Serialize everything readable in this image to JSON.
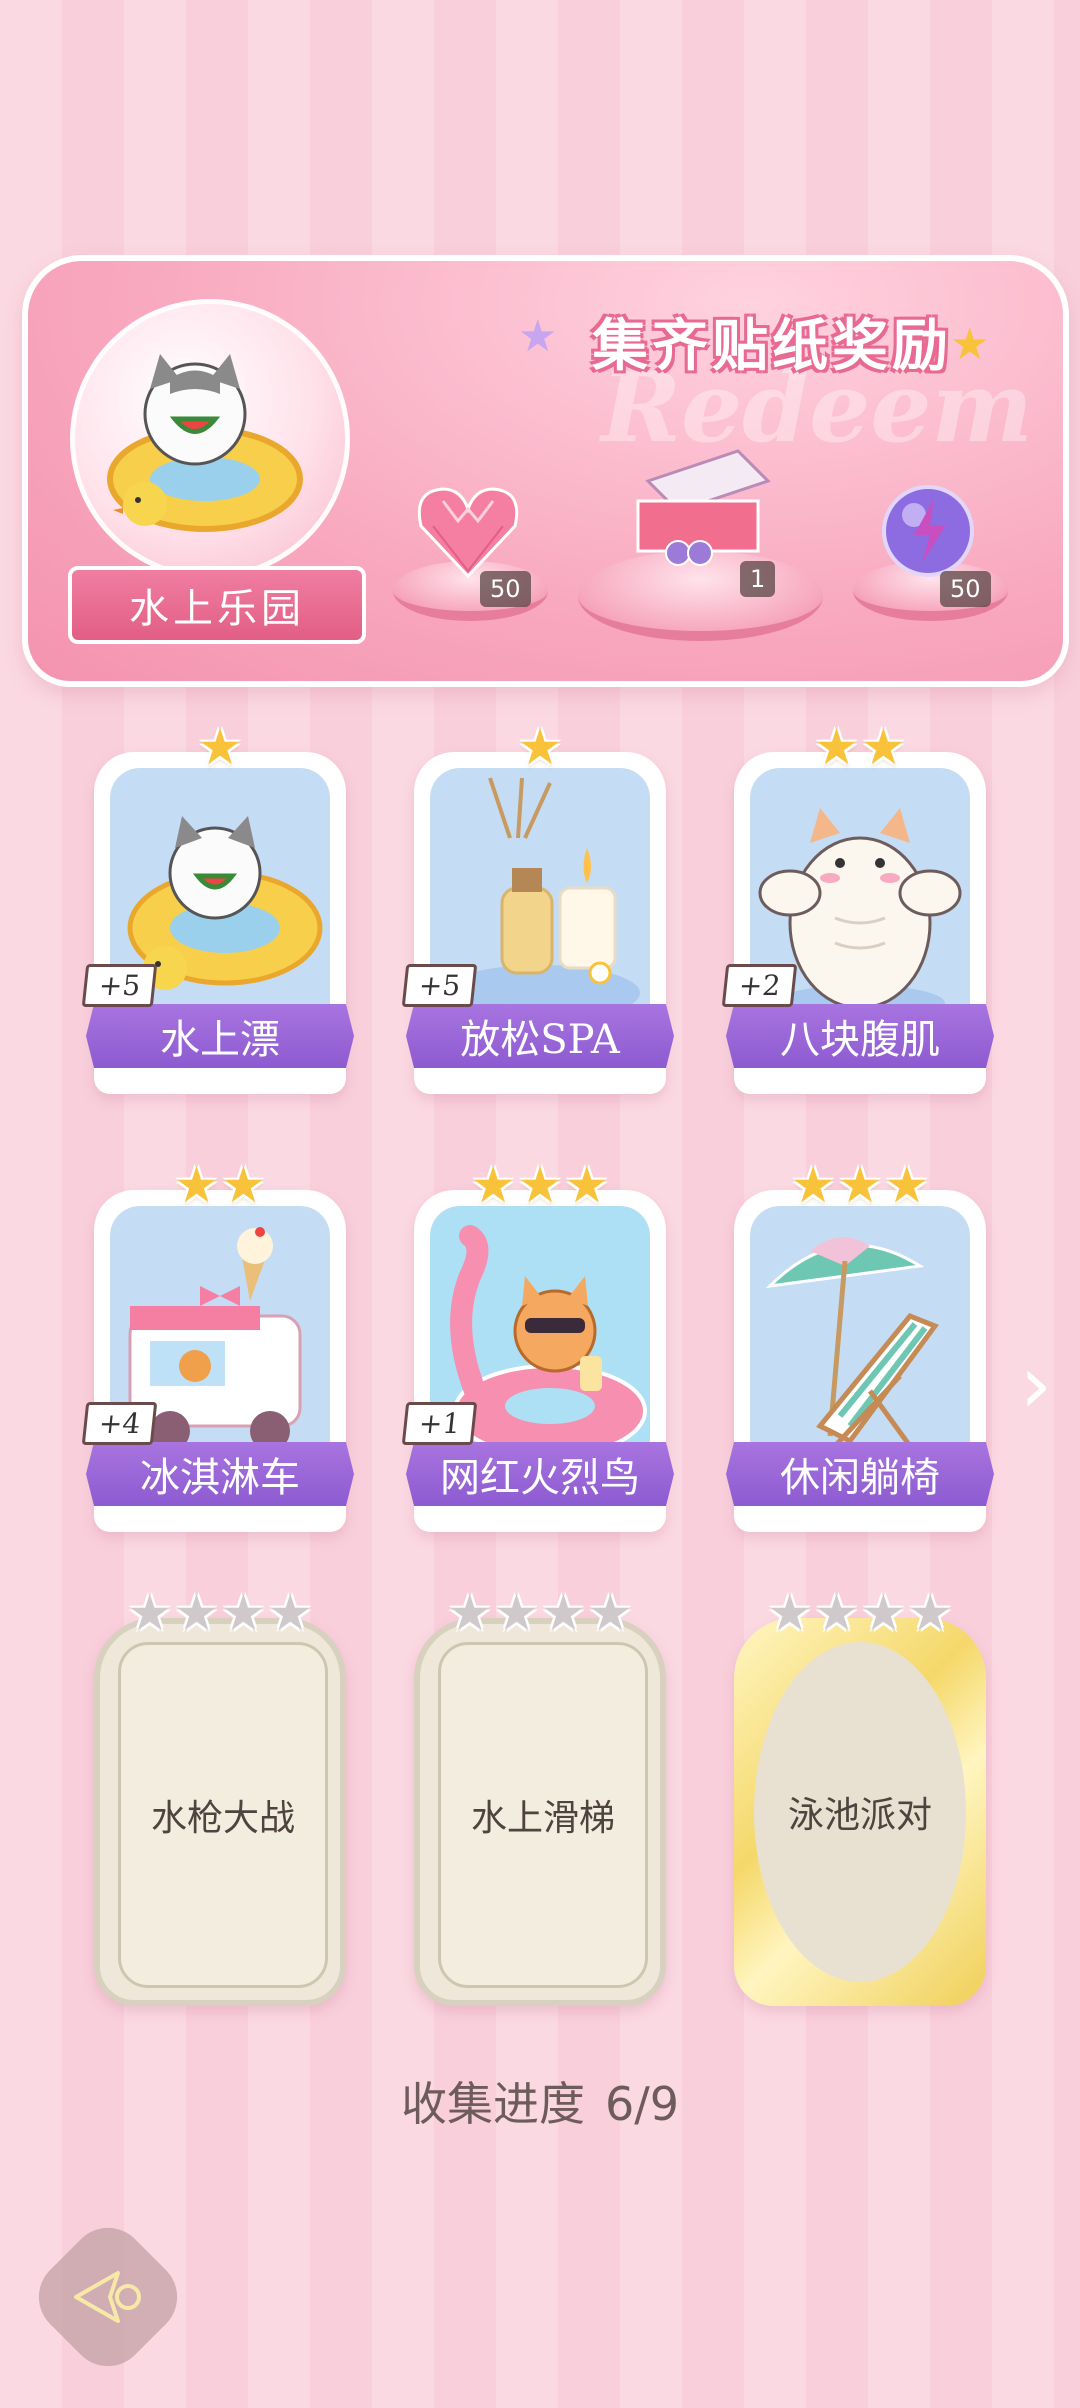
{
  "banner": {
    "title": "集齐贴纸奖励",
    "watermark": "Redeem",
    "theme_name": "水上乐园",
    "rewards": [
      {
        "icon": "pink-heart-gem-icon",
        "count": "50"
      },
      {
        "icon": "gift-box-icon",
        "count": "1"
      },
      {
        "icon": "purple-lightning-orb-icon",
        "count": "50"
      }
    ]
  },
  "cards": [
    {
      "label": "水上漂",
      "plus": "+5",
      "stars": 1,
      "art": "cat-swim-ring"
    },
    {
      "label": "放松SPA",
      "plus": "+5",
      "stars": 1,
      "art": "spa-candle"
    },
    {
      "label": "八块腹肌",
      "plus": "+2",
      "stars": 2,
      "art": "muscle-cat"
    },
    {
      "label": "冰淇淋车",
      "plus": "+4",
      "stars": 2,
      "art": "ice-cream-truck"
    },
    {
      "label": "网红火烈鸟",
      "plus": "+1",
      "stars": 3,
      "art": "flamingo-cat"
    },
    {
      "label": "休闲躺椅",
      "plus": "",
      "stars": 3,
      "art": "beach-chair"
    }
  ],
  "locked_cards": [
    {
      "label": "水枪大战",
      "stars": 4,
      "style": "plain"
    },
    {
      "label": "水上滑梯",
      "stars": 4,
      "style": "plain"
    },
    {
      "label": "泳池派对",
      "stars": 4,
      "style": "gold"
    }
  ],
  "progress": {
    "label": "收集进度",
    "value": "6/9"
  },
  "colors": {
    "card_label": "#8d5bd1",
    "star_gold": "#f8c23b",
    "banner_pink": "#f493b0"
  }
}
